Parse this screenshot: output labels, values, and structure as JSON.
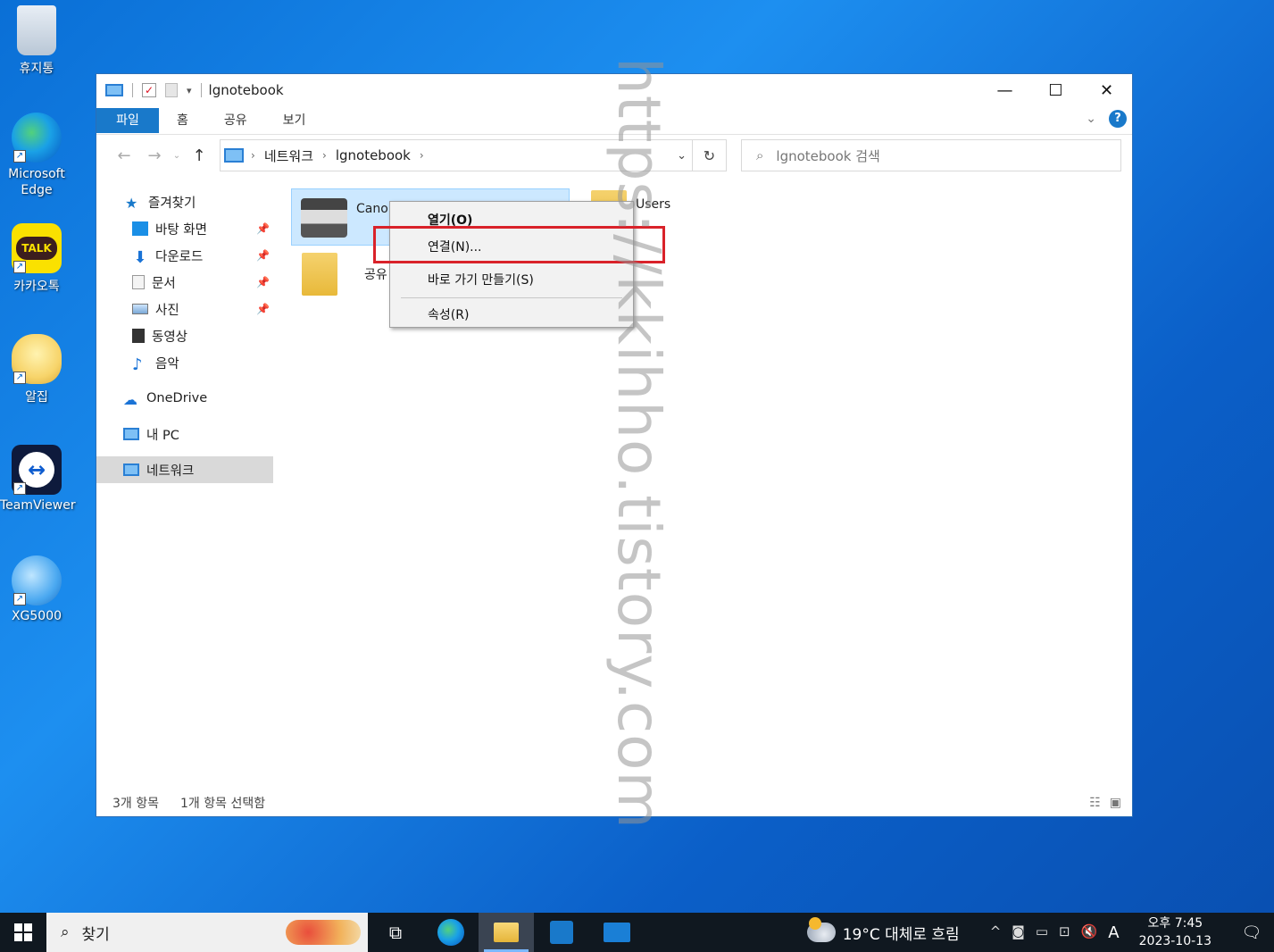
{
  "desktop": {
    "icons": [
      {
        "label": "휴지통",
        "icon": "recycle-bin-icon"
      },
      {
        "label": "Microsoft Edge",
        "icon": "edge-icon"
      },
      {
        "label": "카카오톡",
        "icon": "kakaotalk-icon",
        "badge": "TALK"
      },
      {
        "label": "알집",
        "icon": "alzip-icon"
      },
      {
        "label": "TeamViewer",
        "icon": "teamviewer-icon"
      },
      {
        "label": "XG5000",
        "icon": "xg5000-icon"
      }
    ]
  },
  "window": {
    "title": "lgnotebook",
    "ribbon_tabs": [
      "파일",
      "홈",
      "공유",
      "보기"
    ],
    "address": {
      "crumbs": [
        "네트워크",
        "lgnotebook"
      ]
    },
    "search_placeholder": "lgnotebook 검색",
    "sidebar": {
      "quick_access": "즐겨찾기",
      "items": [
        {
          "label": "바탕 화면",
          "pinned": true
        },
        {
          "label": "다운로드",
          "pinned": true
        },
        {
          "label": "문서",
          "pinned": true
        },
        {
          "label": "사진",
          "pinned": true
        },
        {
          "label": "동영상",
          "pinned": false
        },
        {
          "label": "음악",
          "pinned": false
        }
      ],
      "onedrive": "OneDrive",
      "thispc": "내 PC",
      "network": "네트워크"
    },
    "content_items": [
      {
        "label": "Canon",
        "type": "printer",
        "selected": true
      },
      {
        "label": "Users",
        "type": "folder",
        "selected": false
      },
      {
        "label": "공유",
        "type": "folder",
        "selected": false
      }
    ],
    "status": {
      "count": "3개 항목",
      "selected": "1개 항목 선택함"
    }
  },
  "context_menu": {
    "items": [
      "열기(O)",
      "연결(N)...",
      "바로 가기 만들기(S)",
      "속성(R)"
    ]
  },
  "watermark": "https://kkihho.tistory.com",
  "taskbar": {
    "search_label": "찾기",
    "weather": "19°C 대체로 흐림",
    "ime": "A",
    "time": "오후 7:45",
    "date": "2023-10-13"
  }
}
